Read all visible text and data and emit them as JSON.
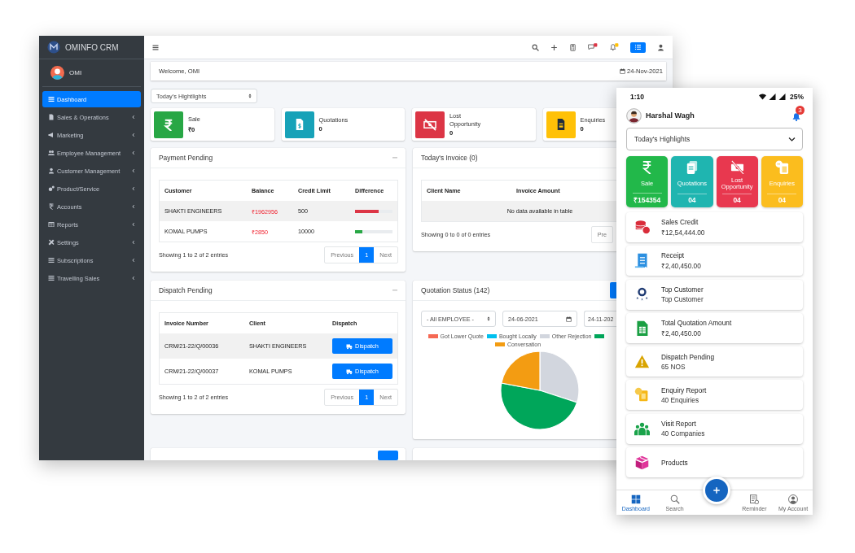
{
  "desktop": {
    "brand": "OMINFO CRM",
    "user": "OMI",
    "sidebar": {
      "items": [
        {
          "label": "Dashboard",
          "selected": true,
          "expandable": false
        },
        {
          "label": "Sales & Operations",
          "selected": false,
          "expandable": true
        },
        {
          "label": "Marketing",
          "selected": false,
          "expandable": true
        },
        {
          "label": "Employee Management",
          "selected": false,
          "expandable": true
        },
        {
          "label": "Customer Management",
          "selected": false,
          "expandable": true
        },
        {
          "label": "Product/Service",
          "selected": false,
          "expandable": true
        },
        {
          "label": "Accounts",
          "selected": false,
          "expandable": true
        },
        {
          "label": "Reports",
          "selected": false,
          "expandable": true
        },
        {
          "label": "Settings",
          "selected": false,
          "expandable": true
        },
        {
          "label": "Subscriptions",
          "selected": false,
          "expandable": true
        },
        {
          "label": "Travelling Sales",
          "selected": false,
          "expandable": true
        }
      ]
    },
    "welcome": "Welcome, OMI",
    "date": "24-Nov-2021",
    "period_select": "Today's Hightlights",
    "stats": [
      {
        "label": "Sale",
        "value": "₹0",
        "color": "#28a745"
      },
      {
        "label": "Quotations",
        "value": "0",
        "color": "#17a2b8"
      },
      {
        "label": "Lost Opportunity",
        "value": "0",
        "color": "#dc3545"
      },
      {
        "label": "Enquiries",
        "value": "0",
        "color": "#ffc107"
      }
    ],
    "payment_pending": {
      "title": "Payment Pending",
      "columns": [
        "Customer",
        "Balance",
        "Credit Limit",
        "Difference"
      ],
      "rows": [
        {
          "customer": "SHAKTI ENGINEERS",
          "balance": "₹1962956",
          "credit_limit": "500",
          "difference": {
            "level": 0.62,
            "color": "#dc3545"
          },
          "selected": true
        },
        {
          "customer": "KOMAL PUMPS",
          "balance": "₹2850",
          "credit_limit": "10000",
          "difference": {
            "level": 0.2,
            "color": "#28a745"
          },
          "selected": false
        }
      ],
      "info": "Showing 1 to 2 of 2 entries",
      "pager": [
        {
          "label": "Previous",
          "selected": false
        },
        {
          "label": "1",
          "selected": true
        },
        {
          "label": "Next",
          "selected": false
        }
      ]
    },
    "todays_invoice": {
      "title": "Today's Invoice (0)",
      "columns": [
        "Client Name",
        "Invoice Amount"
      ],
      "empty": "No data available in table",
      "info": "Showing 0 to 0 of 0 entries",
      "pager": [
        {
          "label": "Pre",
          "selected": false
        }
      ]
    },
    "dispatch_pending": {
      "title": "Dispatch Pending",
      "columns": [
        "Invoice Number",
        "Client",
        "Dispatch"
      ],
      "rows": [
        {
          "invoice": "CRM/21-22/Q/00036",
          "client": "SHAKTI ENGINEERS",
          "action": "Dispatch",
          "selected": true
        },
        {
          "invoice": "CRM/21-22/Q/00037",
          "client": "KOMAL PUMPS",
          "action": "Dispatch",
          "selected": false
        }
      ],
      "info": "Showing 1 to 2 of 2 entries",
      "pager": [
        {
          "label": "Previous",
          "selected": false
        },
        {
          "label": "1",
          "selected": true
        },
        {
          "label": "Next",
          "selected": false
        }
      ]
    },
    "quotation_status": {
      "title": "Quotation Status (142)",
      "employee": "- All EMPLOYEE -",
      "from": "24-06-2021",
      "to": "24-11-202",
      "legend": [
        {
          "label": "Got Lower Quote",
          "color": "#f56954"
        },
        {
          "label": "Bought Locally",
          "color": "#00c0ef"
        },
        {
          "label": "Other Rejection",
          "color": "#d2d6de"
        },
        {
          "color": "#00a65a"
        },
        {
          "label": "Conversation",
          "color": "#f39c12"
        }
      ]
    }
  },
  "phone": {
    "time": "1:10",
    "battery": "25%",
    "user": "Harshal Wagh",
    "badge": "3",
    "period_select": "Today's Highlights",
    "tiles": [
      {
        "label": "Sale",
        "value": "₹154354",
        "color": "#22b84a"
      },
      {
        "label": "Quotations",
        "value": "04",
        "color": "#1fb5b0"
      },
      {
        "label": "Lost Opportunity",
        "value": "04",
        "color": "#e8384f"
      },
      {
        "label": "Enquiries",
        "value": "04",
        "color": "#fbbd1e"
      }
    ],
    "cards": [
      {
        "title": "Sales Credit",
        "value": "₹12,54,444.00"
      },
      {
        "title": "Receipt",
        "value": "₹2,40,450.00"
      },
      {
        "title": "Top Customer",
        "value": "Top Customer"
      },
      {
        "title": "Total Quotation Amount",
        "value": "₹2,40,450.00"
      },
      {
        "title": "Dispatch Pending",
        "value": "65 NOS"
      },
      {
        "title": "Enquiry Report",
        "value": "40 Enquiries"
      },
      {
        "title": "Visit Report",
        "value": "40 Companies"
      },
      {
        "title": "Products"
      }
    ],
    "nav": [
      {
        "label": "Dashboard",
        "selected": true
      },
      {
        "label": "Search",
        "selected": false
      },
      {
        "label": "Reminder",
        "selected": false
      },
      {
        "label": "My Account",
        "selected": false
      }
    ]
  }
}
